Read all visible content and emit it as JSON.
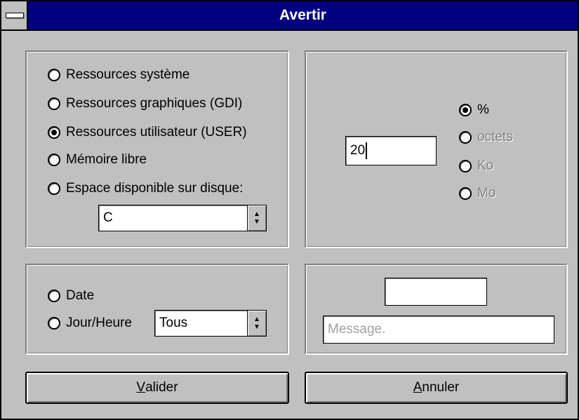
{
  "window": {
    "title": "Avertir"
  },
  "resources": {
    "options": [
      {
        "label": "Ressources système",
        "checked": false
      },
      {
        "label": "Ressources graphiques (GDI)",
        "checked": false
      },
      {
        "label": "Ressources utilisateur (USER)",
        "checked": true
      },
      {
        "label": "Mémoire libre",
        "checked": false
      },
      {
        "label": "Espace disponible sur disque:",
        "checked": false
      }
    ],
    "drive_value": "C"
  },
  "threshold": {
    "value": "20",
    "units": [
      {
        "label": "%",
        "checked": true,
        "enabled": true
      },
      {
        "label": "octets",
        "checked": false,
        "enabled": false
      },
      {
        "label": "Ko",
        "checked": false,
        "enabled": false
      },
      {
        "label": "Mo",
        "checked": false,
        "enabled": false
      }
    ]
  },
  "schedule": {
    "date_label": "Date",
    "dayhour_label": "Jour/Heure",
    "dayhour_value": "Tous"
  },
  "message": {
    "small_value": "",
    "placeholder": "Message."
  },
  "buttons": {
    "ok_mnemonic": "V",
    "ok_rest": "alider",
    "cancel_mnemonic": "A",
    "cancel_rest": "nnuler"
  },
  "icons": {
    "system_menu": "system-menu-icon",
    "combo_arrow": "spin-arrows-icon"
  }
}
